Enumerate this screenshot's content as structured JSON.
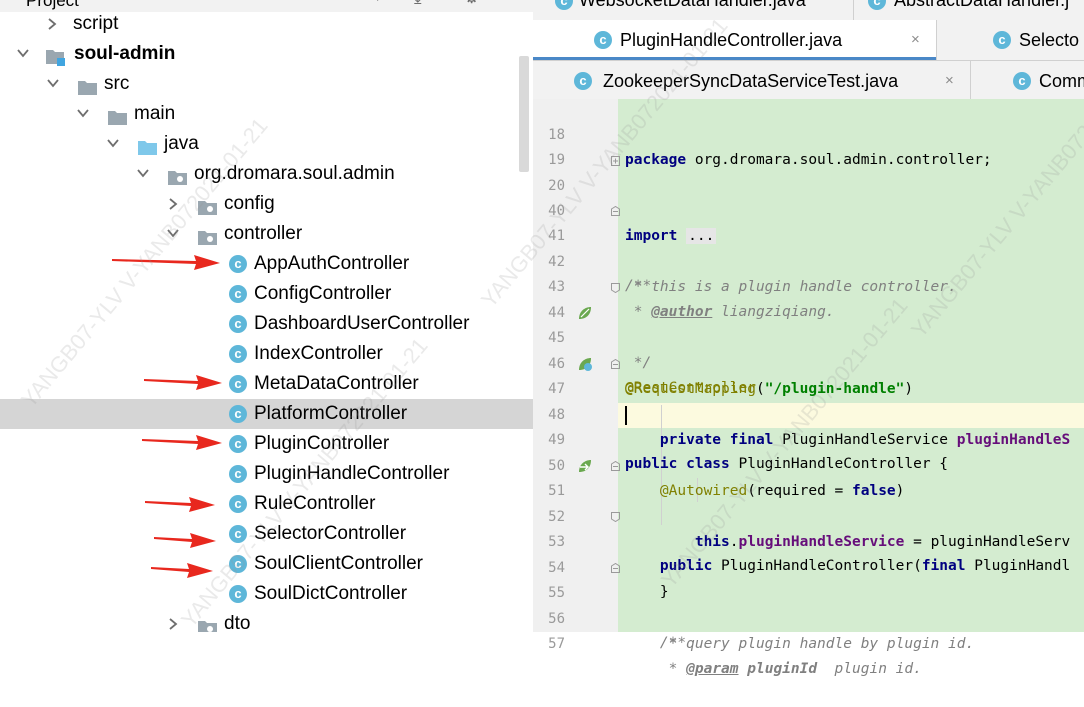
{
  "project_panel": {
    "title": "Project",
    "tree": [
      {
        "label": "script",
        "indent": 0
      },
      {
        "label": "soul-admin",
        "indent": 0
      },
      {
        "label": "src",
        "indent": 1
      },
      {
        "label": "main",
        "indent": 2
      },
      {
        "label": "java",
        "indent": 3
      },
      {
        "label": "org.dromara.soul.admin",
        "indent": 4
      },
      {
        "label": "config",
        "indent": 5
      },
      {
        "label": "controller",
        "indent": 5
      },
      {
        "label": "AppAuthController",
        "indent": 6
      },
      {
        "label": "ConfigController",
        "indent": 6
      },
      {
        "label": "DashboardUserController",
        "indent": 6
      },
      {
        "label": "IndexController",
        "indent": 6
      },
      {
        "label": "MetaDataController",
        "indent": 6
      },
      {
        "label": "PlatformController",
        "indent": 6
      },
      {
        "label": "PluginController",
        "indent": 6
      },
      {
        "label": "PluginHandleController",
        "indent": 6
      },
      {
        "label": "RuleController",
        "indent": 6
      },
      {
        "label": "SelectorController",
        "indent": 6
      },
      {
        "label": "SoulClientController",
        "indent": 6
      },
      {
        "label": "SoulDictController",
        "indent": 6
      },
      {
        "label": "dto",
        "indent": 5
      }
    ],
    "selected": "PlatformController",
    "highlighted_with_arrows": [
      "AppAuthController",
      "MetaDataController",
      "PluginController",
      "RuleController",
      "SelectorController",
      "SoulClientController"
    ]
  },
  "editor": {
    "tab_rows": [
      {
        "tabs": [
          {
            "label": "WebsocketDataHandler.java"
          },
          {
            "label": "AbstractDataHandler.j"
          }
        ]
      },
      {
        "tabs": [
          {
            "label": "PluginHandleController.java",
            "active": true
          },
          {
            "label": "Selecto"
          }
        ]
      },
      {
        "tabs": [
          {
            "label": "ZookeeperSyncDataServiceTest.java"
          },
          {
            "label": "Comm"
          }
        ]
      }
    ],
    "close_glyph": "×",
    "lines": [
      {
        "num": "18",
        "text": "package org.dromara.soul.admin.controller;"
      },
      {
        "num": "19",
        "text": ""
      },
      {
        "num": "20",
        "text": "import ..."
      },
      {
        "num": "40",
        "text": ""
      },
      {
        "num": "41",
        "text": "/**"
      },
      {
        "num": "42",
        "text": " * this is a plugin handle controller."
      },
      {
        "num": "43",
        "text": " * @author liangziqiang."
      },
      {
        "num": "44",
        "text": " */"
      },
      {
        "num": "45",
        "text": "@RestController"
      },
      {
        "num": "46",
        "text": "@RequestMapping(\"/plugin-handle\")"
      },
      {
        "num": "47",
        "text": "public class PluginHandleController {"
      },
      {
        "num": "48",
        "text": "    private final PluginHandleService pluginHandleS"
      },
      {
        "num": "49",
        "text": ""
      },
      {
        "num": "50",
        "text": "    @Autowired(required = false)"
      },
      {
        "num": "51",
        "text": "    public PluginHandleController(final PluginHandl"
      },
      {
        "num": "52",
        "text": "        this.pluginHandleService = pluginHandleServ"
      },
      {
        "num": "53",
        "text": "    }"
      },
      {
        "num": "54",
        "text": ""
      },
      {
        "num": "55",
        "text": "    /**"
      },
      {
        "num": "56",
        "text": "     * query plugin handle by plugin id."
      },
      {
        "num": "57",
        "text": "     * @param pluginId  plugin id."
      }
    ],
    "code_segments": {
      "l18_kw": "package",
      "l18_rest": " org.dromara.soul.admin.controller;",
      "l20_kw": "import",
      "l20_fold": "...",
      "l41": "/**",
      "l42": " * this is a plugin handle controller.",
      "l43_pre": " * ",
      "l43_tag": "@author",
      "l43_post": " liangziqiang.",
      "l44": " */",
      "l45": "@RestController",
      "l46_ann": "@RequestMapping",
      "l46_p1": "(",
      "l46_str": "\"/plugin-handle\"",
      "l46_p2": ")",
      "l47_kw": "public class",
      "l47_rest": " PluginHandleController {",
      "l48_kw": "private final",
      "l48_mid": " PluginHandleService ",
      "l48_fld": "pluginHandleS",
      "l50_ann": "@Autowired",
      "l50_p1": "(required = ",
      "l50_kw": "false",
      "l50_p2": ")",
      "l51_kw": "public",
      "l51_mid": " PluginHandleController(",
      "l51_kw2": "final",
      "l51_rest": " PluginHandl",
      "l52_kw": "this",
      "l52_dot": ".",
      "l52_fld": "pluginHandleService",
      "l52_rest": " = pluginHandleServ",
      "l53": "}",
      "l55": "/**",
      "l56": " * query plugin handle by plugin id.",
      "l57_pre": " * ",
      "l57_tag": "@param",
      "l57_sp": " ",
      "l57_param": "pluginId",
      "l57_post": "  plugin id."
    },
    "current_line": "49"
  },
  "watermark": "YANGB07-YLV V-YANB072021-01-21",
  "colors": {
    "selection": "#d5d5d5",
    "code_bg": "#d4ecd0",
    "current_line": "#fcfadf",
    "keyword": "#000080",
    "string": "#008000",
    "field": "#660e7a",
    "annotation": "#808000",
    "comment": "#808080",
    "class_icon": "#5eb7d9",
    "arrow": "#e8281e"
  }
}
